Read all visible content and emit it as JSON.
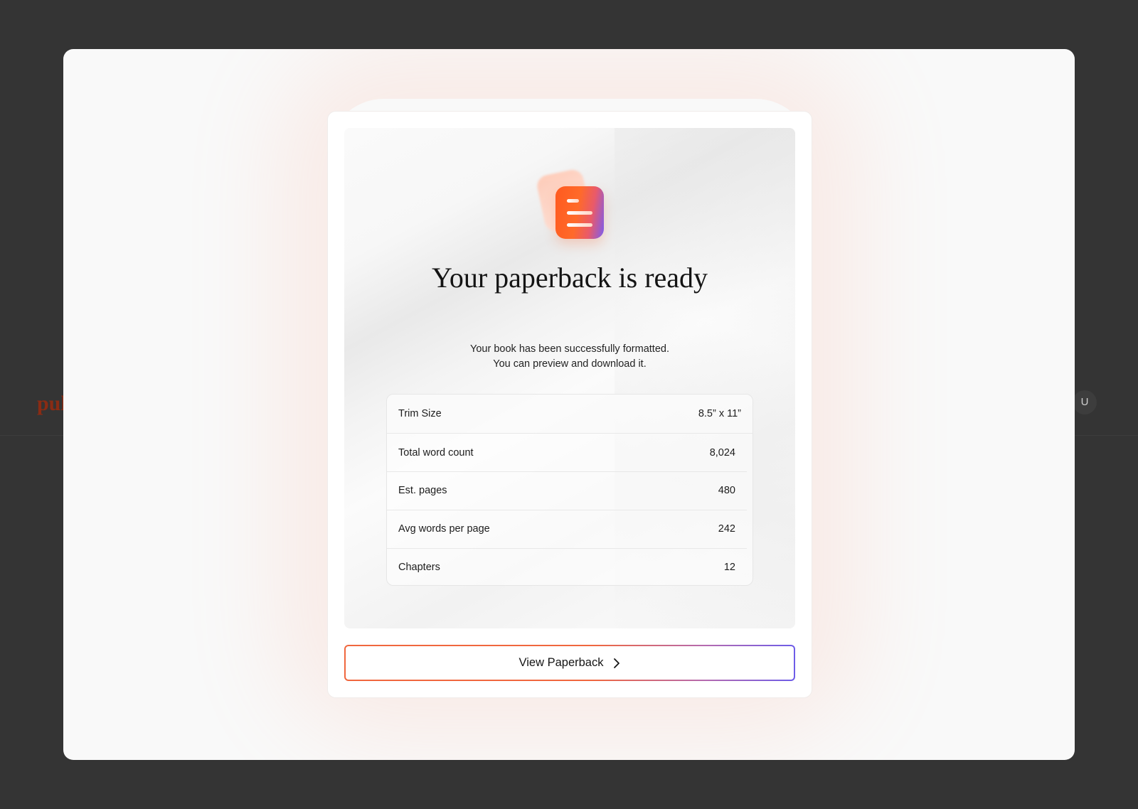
{
  "background": {
    "logo_text": "pul",
    "avatar_initial": "U"
  },
  "modal": {
    "title": "Your paperback is ready",
    "subtitle_lines": [
      "Your book has been successfully formatted.",
      "You can preview and download it."
    ],
    "stats": [
      {
        "label": "Trim Size",
        "value": "8.5” x 11”"
      },
      {
        "label": "Total word count",
        "value": "8,024"
      },
      {
        "label": "Est. pages",
        "value": "480"
      },
      {
        "label": "Avg words per page",
        "value": "242"
      },
      {
        "label": "Chapters",
        "value": "12"
      }
    ],
    "cta_label": "View Paperback",
    "icons": {
      "app": "document-lines-icon",
      "cta": "chevron-right-icon"
    }
  },
  "colors": {
    "backdrop": "#343434",
    "accent_orange": "#ff5a1f",
    "accent_purple": "#7b5cf0",
    "logo": "#8a2b13"
  }
}
